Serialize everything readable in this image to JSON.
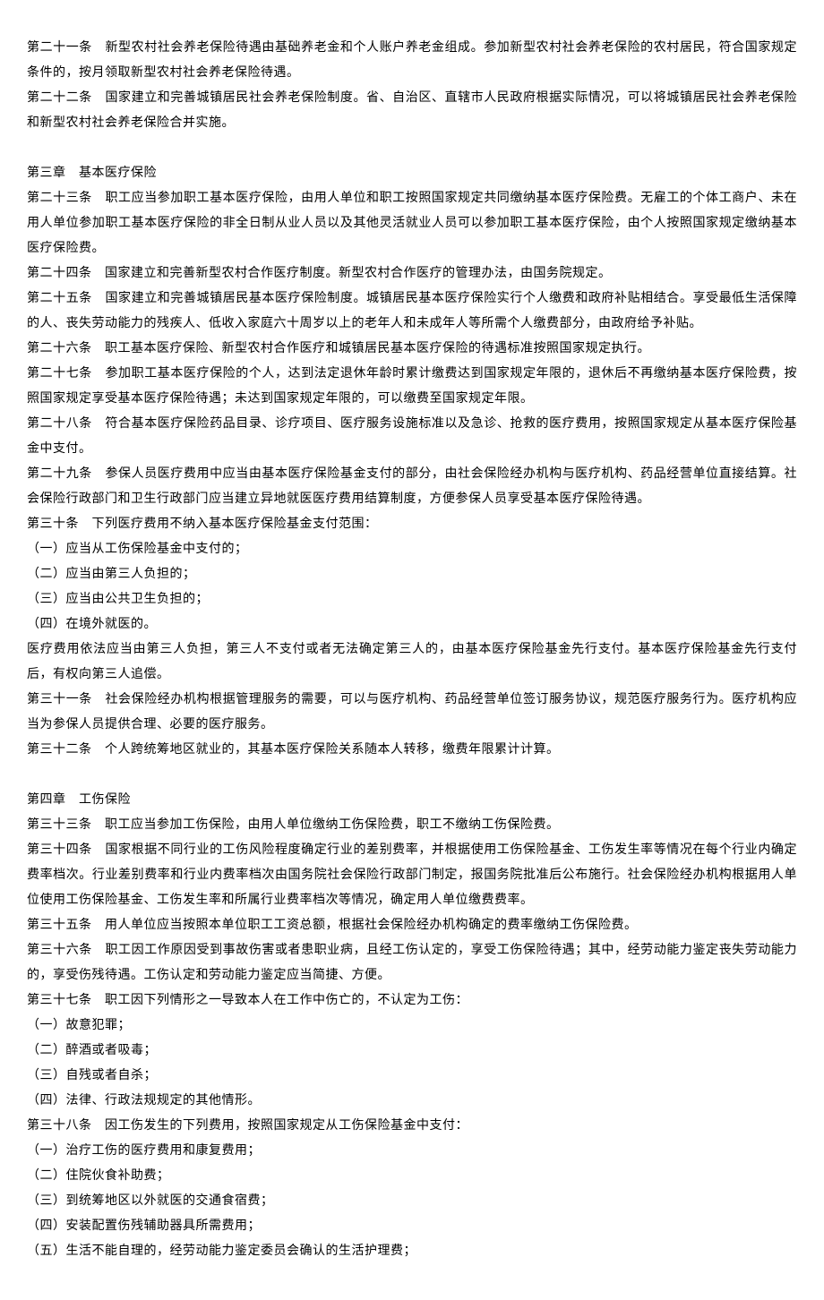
{
  "p": [
    "第二十一条　新型农村社会养老保险待遇由基础养老金和个人账户养老金组成。参加新型农村社会养老保险的农村居民，符合国家规定条件的，按月领取新型农村社会养老保险待遇。",
    "第二十二条　国家建立和完善城镇居民社会养老保险制度。省、自治区、直辖市人民政府根据实际情况，可以将城镇居民社会养老保险和新型农村社会养老保险合并实施。",
    "",
    "第三章　基本医疗保险",
    "第二十三条　职工应当参加职工基本医疗保险，由用人单位和职工按照国家规定共同缴纳基本医疗保险费。无雇工的个体工商户、未在用人单位参加职工基本医疗保险的非全日制从业人员以及其他灵活就业人员可以参加职工基本医疗保险，由个人按照国家规定缴纳基本医疗保险费。",
    "第二十四条　国家建立和完善新型农村合作医疗制度。新型农村合作医疗的管理办法，由国务院规定。",
    "第二十五条　国家建立和完善城镇居民基本医疗保险制度。城镇居民基本医疗保险实行个人缴费和政府补贴相结合。享受最低生活保障的人、丧失劳动能力的残疾人、低收入家庭六十周岁以上的老年人和未成年人等所需个人缴费部分，由政府给予补贴。",
    "第二十六条　职工基本医疗保险、新型农村合作医疗和城镇居民基本医疗保险的待遇标准按照国家规定执行。",
    "第二十七条　参加职工基本医疗保险的个人，达到法定退休年龄时累计缴费达到国家规定年限的，退休后不再缴纳基本医疗保险费，按照国家规定享受基本医疗保险待遇；未达到国家规定年限的，可以缴费至国家规定年限。",
    "第二十八条　符合基本医疗保险药品目录、诊疗项目、医疗服务设施标准以及急诊、抢救的医疗费用，按照国家规定从基本医疗保险基金中支付。",
    "第二十九条　参保人员医疗费用中应当由基本医疗保险基金支付的部分，由社会保险经办机构与医疗机构、药品经营单位直接结算。社会保险行政部门和卫生行政部门应当建立异地就医医疗费用结算制度，方便参保人员享受基本医疗保险待遇。",
    "第三十条　下列医疗费用不纳入基本医疗保险基金支付范围：",
    "（一）应当从工伤保险基金中支付的；",
    "（二）应当由第三人负担的；",
    "（三）应当由公共卫生负担的；",
    "（四）在境外就医的。",
    "医疗费用依法应当由第三人负担，第三人不支付或者无法确定第三人的，由基本医疗保险基金先行支付。基本医疗保险基金先行支付后，有权向第三人追偿。",
    "第三十一条　社会保险经办机构根据管理服务的需要，可以与医疗机构、药品经营单位签订服务协议，规范医疗服务行为。医疗机构应当为参保人员提供合理、必要的医疗服务。",
    "第三十二条　个人跨统筹地区就业的，其基本医疗保险关系随本人转移，缴费年限累计计算。",
    "",
    "第四章　工伤保险",
    "第三十三条　职工应当参加工伤保险，由用人单位缴纳工伤保险费，职工不缴纳工伤保险费。",
    "第三十四条　国家根据不同行业的工伤风险程度确定行业的差别费率，并根据使用工伤保险基金、工伤发生率等情况在每个行业内确定费率档次。行业差别费率和行业内费率档次由国务院社会保险行政部门制定，报国务院批准后公布施行。社会保险经办机构根据用人单位使用工伤保险基金、工伤发生率和所属行业费率档次等情况，确定用人单位缴费费率。",
    "第三十五条　用人单位应当按照本单位职工工资总额，根据社会保险经办机构确定的费率缴纳工伤保险费。",
    "第三十六条　职工因工作原因受到事故伤害或者患职业病，且经工伤认定的，享受工伤保险待遇；其中，经劳动能力鉴定丧失劳动能力的，享受伤残待遇。工伤认定和劳动能力鉴定应当简捷、方便。",
    "第三十七条　职工因下列情形之一导致本人在工作中伤亡的，不认定为工伤：",
    "（一）故意犯罪；",
    "（二）醉酒或者吸毒；",
    "（三）自残或者自杀；",
    "（四）法律、行政法规规定的其他情形。",
    "第三十八条　因工伤发生的下列费用，按照国家规定从工伤保险基金中支付：",
    "（一）治疗工伤的医疗费用和康复费用；",
    "（二）住院伙食补助费；",
    "（三）到统筹地区以外就医的交通食宿费；",
    "（四）安装配置伤残辅助器具所需费用；",
    "（五）生活不能自理的，经劳动能力鉴定委员会确认的生活护理费；"
  ]
}
